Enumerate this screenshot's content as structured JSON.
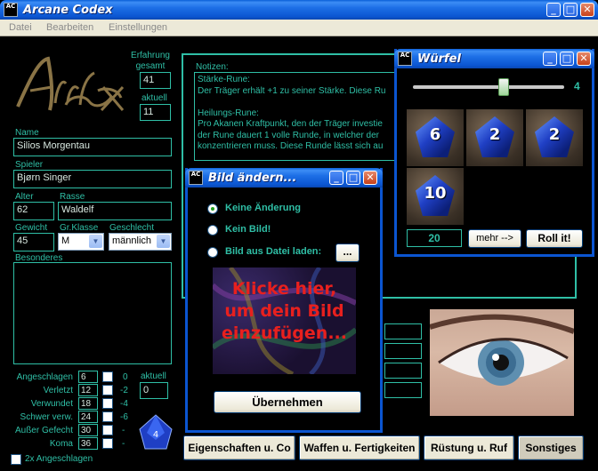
{
  "app": {
    "title": "Arcane Codex",
    "logo_text": "ArCane Codex",
    "icon_text": "AC"
  },
  "menu": [
    "Datei",
    "Bearbeiten",
    "Einstellungen"
  ],
  "character": {
    "erfahrung_label": "Erfahrung gesamt",
    "erfahrung_gesamt": "41",
    "aktuell_label": "aktuell",
    "erfahrung_aktuell": "11",
    "name_label": "Name",
    "name": "Silios Morgentau",
    "spieler_label": "Spieler",
    "spieler": "Bjørn Singer",
    "alter_label": "Alter",
    "alter": "62",
    "rasse_label": "Rasse",
    "rasse": "Waldelf",
    "gewicht_label": "Gewicht",
    "gewicht": "45",
    "grklasse_label": "Gr.Klasse",
    "grklasse": "M",
    "geschlecht_label": "Geschlecht",
    "geschlecht": "männlich",
    "besonderes_label": "Besonderes"
  },
  "wounds": {
    "rows": [
      {
        "label": "Angeschlagen",
        "value": "6",
        "penalty": "0"
      },
      {
        "label": "Verletzt",
        "value": "12",
        "penalty": "-2"
      },
      {
        "label": "Verwundet",
        "value": "18",
        "penalty": "-4"
      },
      {
        "label": "Schwer verw.",
        "value": "24",
        "penalty": "-6"
      },
      {
        "label": "Außer Gefecht",
        "value": "30",
        "penalty": "-"
      },
      {
        "label": "Koma",
        "value": "36",
        "penalty": "-"
      }
    ],
    "aktuell_label": "aktuell",
    "aktuell_value": "0",
    "double_label": "2x Angeschlagen"
  },
  "notes": {
    "label": "Notizen:",
    "lines": [
      "Stärke-Rune:",
      "Der Träger erhält +1 zu seiner Stärke. Diese Ru",
      "",
      "Heilungs-Rune:",
      "Pro Akanen Kraftpunkt, den der Träger investie",
      "der Rune dauert 1 volle Runde, in welcher der",
      "konzentrieren muss. Diese Runde lässt sich au"
    ]
  },
  "tabs": [
    "Eigenschaften u. Co",
    "Waffen u. Fertigkeiten",
    "Rüstung u. Ruf",
    "Sonstiges"
  ],
  "dice_window": {
    "title": "Würfel",
    "slider_value": "4",
    "slider_level": 0.6,
    "dice": [
      "6",
      "2",
      "2",
      "10"
    ],
    "total": "20",
    "more_label": "mehr -->",
    "roll_label": "Roll it!"
  },
  "image_dialog": {
    "title": "Bild ändern...",
    "options": [
      {
        "label": "Keine Änderung",
        "selected": true
      },
      {
        "label": "Kein Bild!",
        "selected": false
      },
      {
        "label": "Bild aus Datei laden:",
        "selected": false
      }
    ],
    "browse_label": "...",
    "preview_text": [
      "Klicke hier,",
      "um dein Bild",
      "einzufügen..."
    ],
    "apply_label": "Übernehmen"
  },
  "colors": {
    "accent": "#2fbfa6",
    "titlebar": "#0b55d1",
    "preview_text": "#e8201e"
  }
}
